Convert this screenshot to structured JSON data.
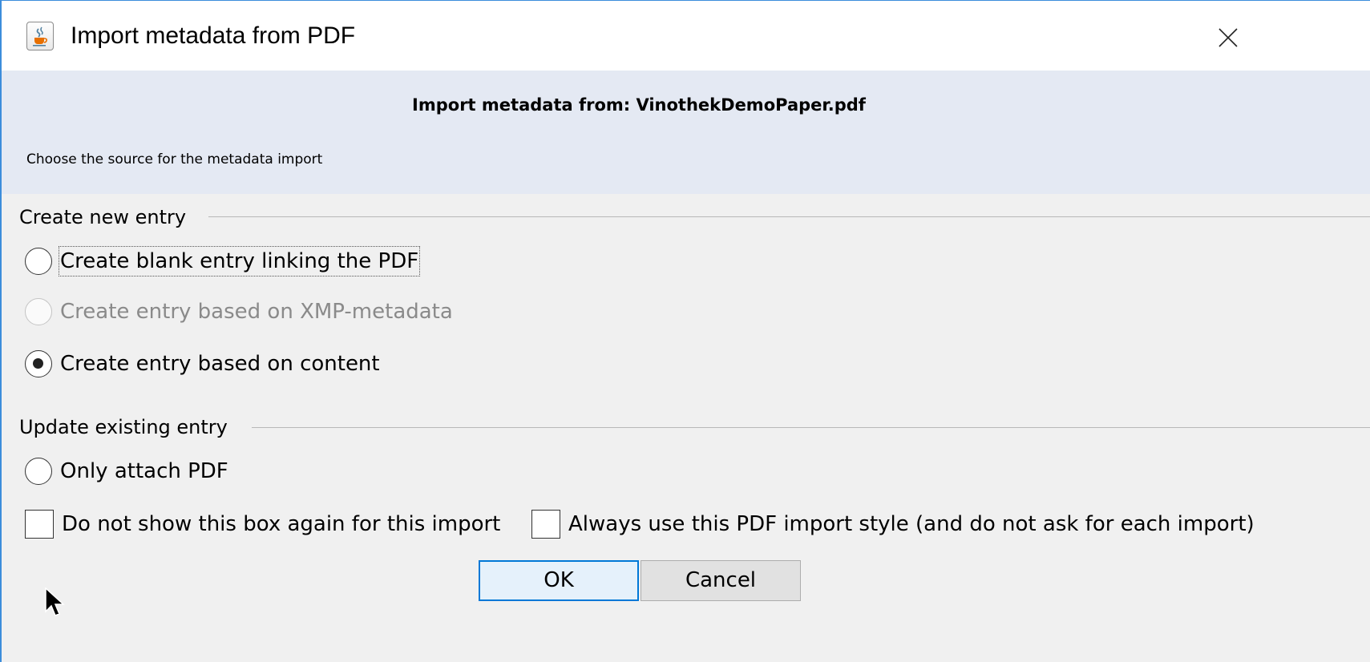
{
  "window": {
    "title": "Import metadata from PDF",
    "app_icon": "java-cup-icon",
    "close_icon": "close-icon"
  },
  "header": {
    "title": "Import metadata from: VinothekDemoPaper.pdf",
    "subtitle": "Choose the source for the metadata import",
    "background_color": "#e4e9f3"
  },
  "create_group": {
    "title": "Create new entry",
    "options": [
      {
        "label": "Create blank entry linking the PDF",
        "selected": false,
        "enabled": true,
        "focused": true
      },
      {
        "label": "Create entry based on XMP-metadata",
        "selected": false,
        "enabled": false,
        "focused": false
      },
      {
        "label": "Create entry based on content",
        "selected": true,
        "enabled": true,
        "focused": false
      }
    ]
  },
  "update_group": {
    "title": "Update existing entry",
    "options": [
      {
        "label": "Only attach PDF",
        "selected": false,
        "enabled": true
      }
    ]
  },
  "checkboxes": [
    {
      "label": "Do not show this box again for this import",
      "checked": false
    },
    {
      "label": "Always use this PDF import style (and do not ask for each import)",
      "checked": false
    }
  ],
  "buttons": {
    "ok_label": "OK",
    "cancel_label": "Cancel"
  },
  "colors": {
    "accent": "#0078d7",
    "window_border": "#3c8ddb",
    "disabled_text": "#8a8a8a"
  }
}
